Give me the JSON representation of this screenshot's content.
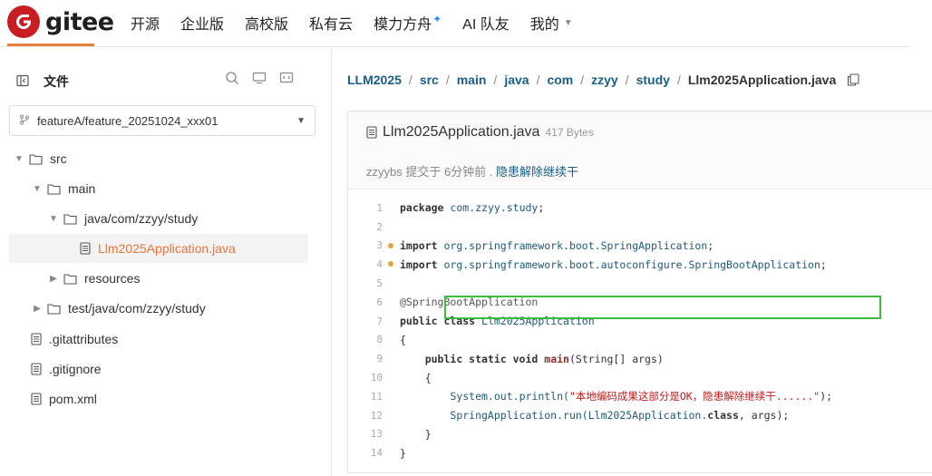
{
  "app": {
    "logo_text": "gitee",
    "brand_color": "#c71d23",
    "accent_color": "#e8743a",
    "link_color": "#1a5e88",
    "highlight_color": "#3cbc3c"
  },
  "nav": {
    "items": [
      "开源",
      "企业版",
      "高校版",
      "私有云",
      "模力方舟",
      "AI 队友",
      "我的"
    ]
  },
  "sidebar": {
    "title": "文件",
    "icons": [
      "panel-icon",
      "search-icon",
      "monitor-icon",
      "code-view-icon"
    ],
    "branch": "featureA/feature_20251024_xxx01",
    "tree": [
      {
        "label": "src",
        "type": "folder",
        "expanded": true,
        "depth": 0
      },
      {
        "label": "main",
        "type": "folder",
        "expanded": true,
        "depth": 1
      },
      {
        "label": "java/com/zzyy/study",
        "type": "folder",
        "expanded": true,
        "depth": 2
      },
      {
        "label": "Llm2025Application.java",
        "type": "file",
        "active": true,
        "depth": 3
      },
      {
        "label": "resources",
        "type": "folder",
        "expanded": false,
        "depth": 2
      },
      {
        "label": "test/java/com/zzyy/study",
        "type": "folder",
        "expanded": false,
        "depth": 1
      },
      {
        "label": ".gitattributes",
        "type": "file",
        "depth": 0
      },
      {
        "label": ".gitignore",
        "type": "file",
        "depth": 0
      },
      {
        "label": "pom.xml",
        "type": "file",
        "depth": 0
      }
    ]
  },
  "breadcrumb": [
    "LLM2025",
    "src",
    "main",
    "java",
    "com",
    "zzyy",
    "study",
    "Llm2025Application.java"
  ],
  "file": {
    "name": "Llm2025Application.java",
    "size": "417 Bytes",
    "commit_prefix": "zzyybs 提交于 6分钟前 .",
    "commit_message": "隐患解除继续干"
  },
  "code": {
    "line_numbers": [
      "1",
      "2",
      "3",
      "4",
      "5",
      "6",
      "7",
      "8",
      "9",
      "10",
      "11",
      "12",
      "13",
      "14"
    ],
    "modified_lines": [
      3,
      4
    ],
    "l1_kw": "package",
    "l1_pkg": "com.zzyy.study",
    "l3_kw": "import",
    "l3_pkg": "org.springframework.boot.SpringApplication",
    "l4_kw": "import",
    "l4_pkg": "org.springframework.boot.autoconfigure.SpringBootApplication",
    "l6": "@SpringBootApplication",
    "l7_kw": "public class",
    "l7_name": "Llm2025Application",
    "l8": "{",
    "l9_kw": "public static void",
    "l9_fn": "main",
    "l9_args": "(String[] args)",
    "l10": "{",
    "l11_a": "System.",
    "l11_b": "out",
    "l11_c": ".println(",
    "l11_str": "\"本地编码成果这部分是OK，隐患解除继续干......\"",
    "l11_d": ");",
    "l12_a": "SpringApplication.",
    "l12_b": "run",
    "l12_c": "(Llm2025Application.",
    "l12_kw": "class",
    "l12_d": ", args);",
    "l13": "}",
    "l14": "}"
  }
}
